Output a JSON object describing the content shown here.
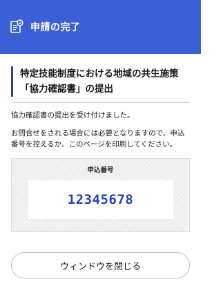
{
  "header": {
    "title": "申請の完了",
    "icon": "document-check-icon"
  },
  "main": {
    "heading_line1": "特定技能制度における地域の共生施策",
    "heading_line2": "「協力確認書」の提出",
    "message": "協力確認書の提出を受け付けました。",
    "note": "お問合せをされる場合には必要となりますので、申込番号を控えるか、このページを印刷してください。",
    "application_number_label": "申込番号",
    "application_number": "12345678"
  },
  "actions": {
    "close_label": "ウィンドウを閉じる"
  },
  "colors": {
    "header_bg": "#3a5fd6",
    "accent": "#2b3fa8",
    "number": "#2444b8"
  }
}
